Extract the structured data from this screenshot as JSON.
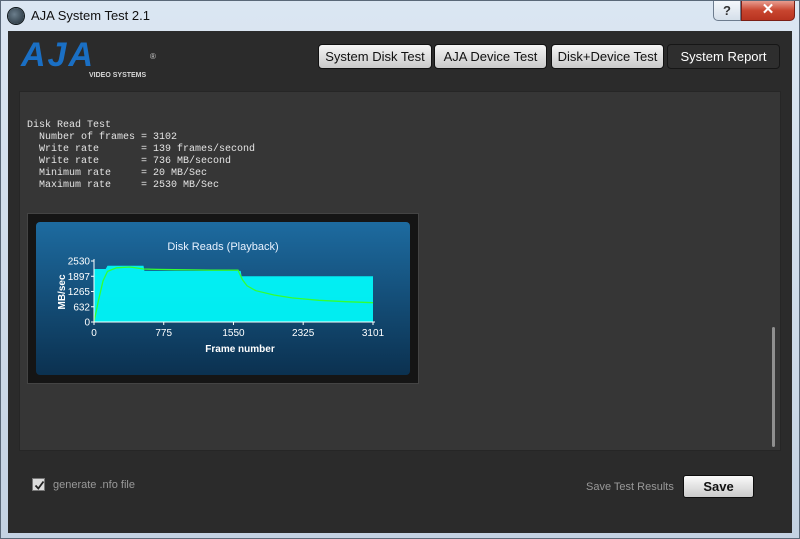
{
  "window": {
    "title": "AJA System Test 2.1",
    "help_label": "?",
    "close_label": "✕"
  },
  "logo": {
    "name": "AJA",
    "subtitle": "VIDEO SYSTEMS",
    "mark": "®"
  },
  "nav": {
    "system_disk_test": "System Disk Test",
    "aja_device_test": "AJA Device Test",
    "disk_device_test": "Disk+Device Test",
    "system_report": "System Report"
  },
  "results": {
    "heading": "Disk Read Test",
    "lines": [
      "  Number of frames = 3102",
      "  Write rate       = 139 frames/second",
      "  Write rate       = 736 MB/second",
      "  Minimum rate     = 20 MB/Sec",
      "  Maximum rate     = 2530 MB/Sec"
    ]
  },
  "chart_data": {
    "type": "line",
    "title": "Disk Reads (Playback)",
    "xlabel": "Frame number",
    "ylabel": "MB/sec",
    "xlim": [
      0,
      3101
    ],
    "ylim": [
      0,
      2530
    ],
    "x_ticks": [
      0,
      775,
      1550,
      2325,
      3101
    ],
    "y_ticks": [
      0,
      632,
      1265,
      1897,
      2530
    ],
    "series": [
      {
        "color": "#00ffff",
        "x": [
          0,
          130,
          150,
          550,
          560,
          1630,
          1640,
          3101
        ],
        "values": [
          2200,
          2200,
          2330,
          2330,
          2120,
          2120,
          1900,
          1900
        ]
      },
      {
        "color": "#33ff33",
        "x": [
          0,
          50,
          100,
          150,
          250,
          400,
          550,
          700,
          900,
          1100,
          1300,
          1500,
          1600,
          1650,
          1700,
          1800,
          2000,
          2200,
          2500,
          2800,
          3101
        ],
        "values": [
          0,
          900,
          1700,
          2100,
          2250,
          2280,
          2200,
          2180,
          2170,
          2160,
          2150,
          2150,
          2150,
          1750,
          1500,
          1300,
          1120,
          1000,
          900,
          840,
          800
        ]
      }
    ],
    "grid": false,
    "legend": "none"
  },
  "footer": {
    "generate_nfo_label": "generate .nfo file",
    "generate_nfo_checked": true,
    "save_results_label": "Save Test Results",
    "save_button": "Save"
  }
}
